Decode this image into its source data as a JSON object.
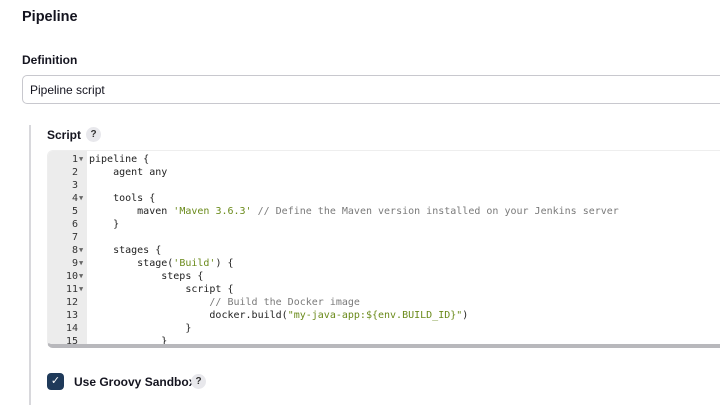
{
  "title": "Pipeline",
  "definition": {
    "label": "Definition",
    "value": "Pipeline script"
  },
  "script": {
    "label": "Script",
    "help": "?",
    "lines": [
      [
        {
          "t": "pipeline {"
        }
      ],
      [
        {
          "t": "    agent any"
        }
      ],
      [
        {
          "t": ""
        }
      ],
      [
        {
          "t": "    tools {"
        }
      ],
      [
        {
          "t": "        maven "
        },
        {
          "t": "'Maven 3.6.3'",
          "c": "str"
        },
        {
          "t": " // Define the Maven version installed on your Jenkins server",
          "c": "cmt"
        }
      ],
      [
        {
          "t": "    }"
        }
      ],
      [
        {
          "t": ""
        }
      ],
      [
        {
          "t": "    stages {"
        }
      ],
      [
        {
          "t": "        stage("
        },
        {
          "t": "'Build'",
          "c": "str"
        },
        {
          "t": ") {"
        }
      ],
      [
        {
          "t": "            steps {"
        }
      ],
      [
        {
          "t": "                script {"
        }
      ],
      [
        {
          "t": "                    // Build the Docker image",
          "c": "cmt"
        }
      ],
      [
        {
          "t": "                    docker.build("
        },
        {
          "t": "\"my-java-app:${env.BUILD_ID}\"",
          "c": "str"
        },
        {
          "t": ")"
        }
      ],
      [
        {
          "t": "                }"
        }
      ],
      [
        {
          "t": "            }"
        }
      ],
      [
        {
          "t": "        }"
        }
      ]
    ],
    "foldable": [
      1,
      4,
      8,
      9,
      10,
      11
    ]
  },
  "sandbox": {
    "label": "Use Groovy Sandbox",
    "checked": true,
    "help": "?"
  }
}
